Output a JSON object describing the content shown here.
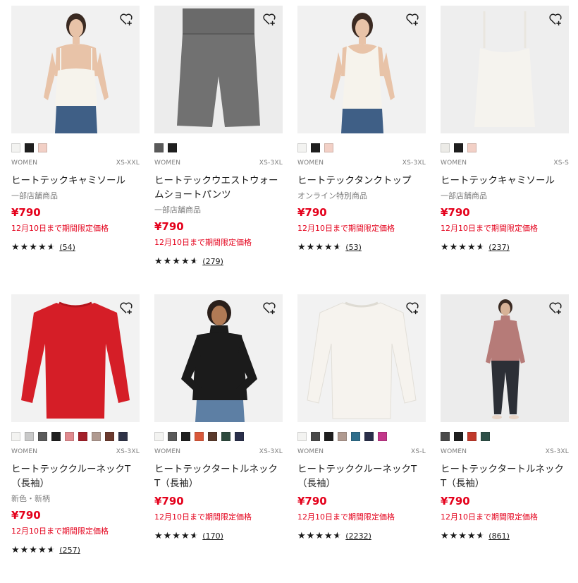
{
  "products": [
    {
      "gender": "WOMEN",
      "sizes": "XS-XXL",
      "name": "ヒートテックキャミソール",
      "sub": "一部店舗商品",
      "price": "¥790",
      "promo": "12月10日まで期間限定価格",
      "stars": "★★★★",
      "count": "(54)",
      "image": "woman-white-camisole",
      "swatches": [
        "#f3f3f1",
        "#1f1f1f",
        "#f2d0c6"
      ]
    },
    {
      "gender": "WOMEN",
      "sizes": "XS-3XL",
      "name": "ヒートテックウエストウォームショートパンツ",
      "sub": "一部店舗商品",
      "price": "¥790",
      "promo": "12月10日まで期間限定価格",
      "stars": "★★★★",
      "count": "(279)",
      "image": "grey-short-pants",
      "swatches": [
        "#5a5a5a",
        "#1f1f1f"
      ]
    },
    {
      "gender": "WOMEN",
      "sizes": "XS-3XL",
      "name": "ヒートテックタンクトップ",
      "sub": "オンライン特別商品",
      "price": "¥790",
      "promo": "12月10日まで期間限定価格",
      "stars": "★★★★",
      "count": "(53)",
      "image": "woman-tank-top",
      "swatches": [
        "#f3f3f1",
        "#1f1f1f",
        "#f2d0c6"
      ]
    },
    {
      "gender": "WOMEN",
      "sizes": "XS-S",
      "name": "ヒートテックキャミソール",
      "sub": "一部店舗商品",
      "price": "¥790",
      "promo": "12月10日まで期間限定価格",
      "stars": "★★★★",
      "count": "(237)",
      "image": "white-camisole-flat",
      "swatches": [
        "#ecebe7",
        "#1f1f1f",
        "#f2d0c6"
      ]
    },
    {
      "gender": "WOMEN",
      "sizes": "XS-3XL",
      "name": "ヒートテッククルーネックT（長袖）",
      "sub": "新色・新柄",
      "price": "¥790",
      "promo": "12月10日まで期間限定価格",
      "stars": "★★★★",
      "count": "(257)",
      "image": "red-long-sleeve-tee",
      "swatches": [
        "#f3f3f1",
        "#c9c9c9",
        "#5a5a5a",
        "#1f1f1f",
        "#e08a8e",
        "#a3202a",
        "#b09a90",
        "#6b3a2e",
        "#2f3347"
      ]
    },
    {
      "gender": "WOMEN",
      "sizes": "XS-3XL",
      "name": "ヒートテックタートルネックT（長袖）",
      "sub": "",
      "price": "¥790",
      "promo": "12月10日まで期間限定価格",
      "stars": "★★★★",
      "count": "(170)",
      "image": "woman-black-turtleneck",
      "swatches": [
        "#f3f3f1",
        "#5a5a5a",
        "#1f1f1f",
        "#d9583a",
        "#5a3a2c",
        "#2e4a3e",
        "#2a2f4a"
      ]
    },
    {
      "gender": "WOMEN",
      "sizes": "XS-L",
      "name": "ヒートテッククルーネックT（長袖）",
      "sub": "",
      "price": "¥790",
      "promo": "12月10日まで期間限定価格",
      "stars": "★★★★",
      "count": "(2232)",
      "image": "white-long-sleeve-tee",
      "swatches": [
        "#f3f3f1",
        "#4a4a4a",
        "#1f1f1f",
        "#b09a90",
        "#2f6e8c",
        "#2a2f4a",
        "#c2378a"
      ]
    },
    {
      "gender": "WOMEN",
      "sizes": "XS-3XL",
      "name": "ヒートテックタートルネックT（長袖）",
      "sub": "",
      "price": "¥790",
      "promo": "12月10日まで期間限定価格",
      "stars": "★★★★",
      "count": "(861)",
      "image": "woman-pink-turtleneck",
      "swatches": [
        "#4a4a4a",
        "#1f1f1f",
        "#c0392b",
        "#2e5048"
      ]
    }
  ]
}
